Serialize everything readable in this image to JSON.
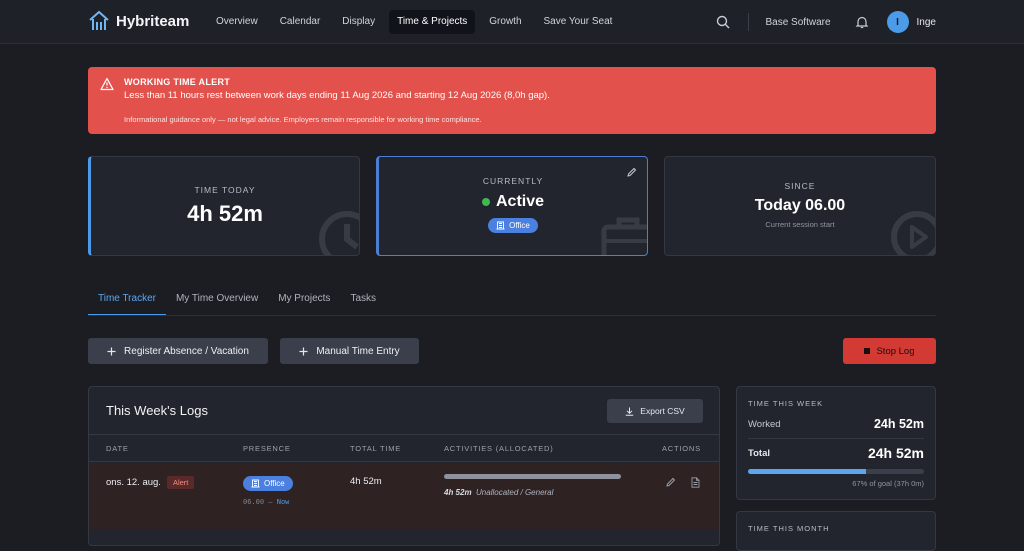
{
  "nav": {
    "brand": "Hybriteam",
    "links": [
      "Overview",
      "Calendar",
      "Display",
      "Time & Projects",
      "Growth",
      "Save Your Seat"
    ],
    "active_index": 3,
    "company": "Base Software",
    "user_initial": "I",
    "user_name": "Inge"
  },
  "alert": {
    "title": "WORKING TIME ALERT",
    "message": "Less than 11 hours rest between work days ending 11 Aug 2026 and starting 12 Aug 2026 (8,0h gap).",
    "note": "Informational guidance only — not legal advice. Employers remain responsible for working time compliance.",
    "color": "#e2514c"
  },
  "cards": {
    "time_today": {
      "label": "TIME TODAY",
      "value": "4h 52m"
    },
    "currently": {
      "label": "CURRENTLY",
      "status": "Active",
      "location": "Office"
    },
    "since": {
      "label": "SINCE",
      "value": "Today 06.00",
      "sub": "Current session start"
    }
  },
  "tabs": [
    "Time Tracker",
    "My Time Overview",
    "My Projects",
    "Tasks"
  ],
  "buttons": {
    "register_absence": "Register Absence / Vacation",
    "manual_entry": "Manual Time Entry",
    "stop_log": "Stop Log"
  },
  "logs": {
    "title": "This Week's Logs",
    "export": "Export CSV",
    "columns": [
      "DATE",
      "PRESENCE",
      "TOTAL TIME",
      "ACTIVITIES (ALLOCATED)",
      "ACTIONS"
    ],
    "rows": [
      {
        "date": "ons. 12. aug.",
        "alert_tag": "Alert",
        "presence": "Office",
        "time_start": "06.00 –",
        "time_end": "Now",
        "total": "4h 52m",
        "activity_duration": "4h 52m",
        "activity_label": "Unallocated / General"
      }
    ]
  },
  "week": {
    "label": "TIME THIS WEEK",
    "worked_label": "Worked",
    "worked_value": "24h 52m",
    "total_label": "Total",
    "total_value": "24h 52m",
    "goal_text": "67% of goal (37h 0m)",
    "goal_fraction": 0.67
  },
  "month": {
    "label": "TIME THIS MONTH"
  }
}
